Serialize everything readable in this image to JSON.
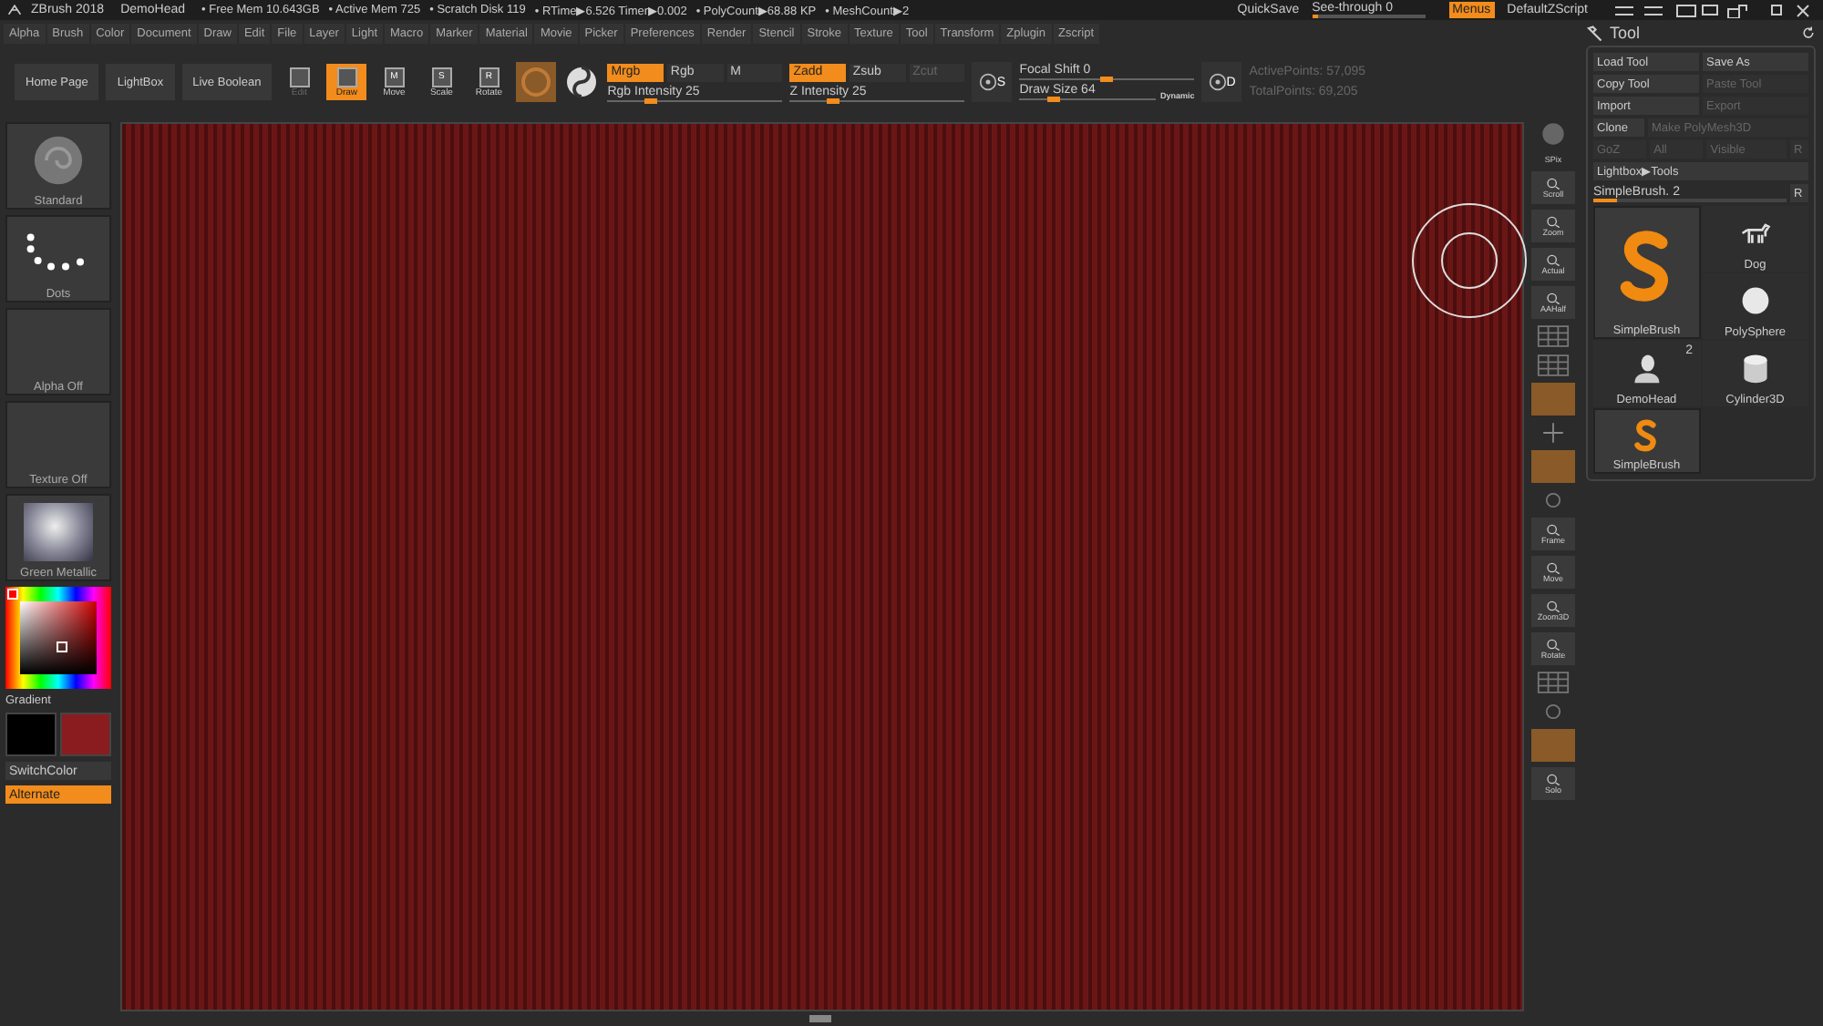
{
  "title_bar": {
    "app": "ZBrush 2018",
    "document": "DemoHead",
    "stats": [
      "• Free Mem 10.643GB",
      "• Active Mem 725",
      "• Scratch Disk 119",
      "• RTime▶6.526 Timer▶0.002",
      "• PolyCount▶68.88 KP",
      "• MeshCount▶2"
    ],
    "quicksave": "QuickSave",
    "see_through": {
      "label": "See-through  0",
      "level": 0.06
    },
    "menus": {
      "label": "Menus",
      "on": true
    },
    "script": "DefaultZScript"
  },
  "menu_bar": [
    "Alpha",
    "Brush",
    "Color",
    "Document",
    "Draw",
    "Edit",
    "File",
    "Layer",
    "Light",
    "Macro",
    "Marker",
    "Material",
    "Movie",
    "Picker",
    "Preferences",
    "Render",
    "Stencil",
    "Stroke",
    "Texture",
    "Tool",
    "Transform",
    "Zplugin",
    "Zscript"
  ],
  "toolbar": {
    "nav_buttons": [
      "Home Page",
      "LightBox",
      "Live Boolean"
    ],
    "modes": [
      {
        "label": "Edit",
        "selected": false,
        "disabled": true
      },
      {
        "label": "Draw",
        "selected": true,
        "disabled": false
      },
      {
        "label": "Move",
        "key": "M",
        "selected": false,
        "disabled": false
      },
      {
        "label": "Scale",
        "key": "S",
        "selected": false,
        "disabled": false
      },
      {
        "label": "Rotate",
        "key": "R",
        "selected": false,
        "disabled": false
      }
    ],
    "color_modes": [
      {
        "label": "Mrgb",
        "on": true
      },
      {
        "label": "Rgb",
        "on": false
      },
      {
        "label": "M",
        "on": false
      }
    ],
    "rgb_intensity": {
      "label": "Rgb Intensity 25",
      "level": 0.25
    },
    "z_modes": [
      {
        "label": "Zadd",
        "on": true,
        "disabled": false
      },
      {
        "label": "Zsub",
        "on": false,
        "disabled": false
      },
      {
        "label": "Zcut",
        "on": false,
        "disabled": true
      }
    ],
    "z_intensity": {
      "label": "Z Intensity 25",
      "level": 0.25
    },
    "s_key": "S",
    "d_key": "D",
    "focal_shift": {
      "label": "Focal Shift 0",
      "level": 0.5
    },
    "draw_size": {
      "label": "Draw Size 64",
      "level": 0.25
    },
    "dynamic": "Dynamic",
    "points": [
      "ActivePoints: 57,095",
      "TotalPoints: 69,205"
    ]
  },
  "left_panel": {
    "thumbs": [
      {
        "label": "Standard",
        "kind": "brush"
      },
      {
        "label": "Dots",
        "kind": "stroke"
      },
      {
        "label": "Alpha Off",
        "kind": "empty"
      },
      {
        "label": "Texture Off",
        "kind": "empty"
      },
      {
        "label": "Green Metallic",
        "kind": "material"
      }
    ],
    "gradient": "Gradient",
    "swatches": [
      {
        "color": "#000000"
      },
      {
        "color": "#8a1c20"
      }
    ],
    "switch_color": "SwitchColor",
    "alternate": {
      "label": "Alternate",
      "on": true
    }
  },
  "right_shelf": [
    {
      "kind": "sphere"
    },
    {
      "label": "SPix",
      "kind": "text"
    },
    {
      "label": "Scroll",
      "kind": "tool"
    },
    {
      "label": "Zoom",
      "kind": "tool"
    },
    {
      "label": "Actual",
      "kind": "tool"
    },
    {
      "label": "AAHalf",
      "kind": "tool"
    },
    {
      "kind": "grid"
    },
    {
      "kind": "grid"
    },
    {
      "kind": "active"
    },
    {
      "kind": "axes"
    },
    {
      "kind": "active"
    },
    {
      "kind": "dim"
    },
    {
      "label": "Frame",
      "kind": "tool"
    },
    {
      "label": "Move",
      "kind": "tool"
    },
    {
      "label": "Zoom3D",
      "kind": "tool"
    },
    {
      "label": "Rotate",
      "kind": "tool"
    },
    {
      "kind": "grid"
    },
    {
      "kind": "dim"
    },
    {
      "kind": "active"
    },
    {
      "label": "Solo",
      "kind": "tool"
    }
  ],
  "tool_panel": {
    "title": "Tool",
    "buttons": [
      {
        "label": "Load Tool",
        "disabled": false
      },
      {
        "label": "Save As",
        "disabled": false
      },
      {
        "label": "Copy Tool",
        "disabled": false
      },
      {
        "label": "Paste Tool",
        "disabled": true
      },
      {
        "label": "Import",
        "disabled": false
      },
      {
        "label": "Export",
        "disabled": true
      }
    ],
    "clone_row": [
      {
        "label": "Clone",
        "disabled": false
      },
      {
        "label": "Make PolyMesh3D",
        "disabled": true
      }
    ],
    "goz_row": [
      {
        "label": "GoZ",
        "disabled": true
      },
      {
        "label": "All",
        "disabled": true
      },
      {
        "label": "Visible",
        "disabled": true
      },
      {
        "label": "R",
        "disabled": true
      }
    ],
    "lightbox": "Lightbox▶Tools",
    "slider": {
      "label": "SimpleBrush. 2",
      "level": 0.12
    },
    "r_button": "R",
    "tools": [
      {
        "name": "SimpleBrush",
        "kind": "brush",
        "selected": true,
        "large": true
      },
      {
        "name": "Dog",
        "kind": "dog",
        "selected": false,
        "large": false
      },
      {
        "name": "PolySphere",
        "kind": "sphere",
        "selected": false,
        "large": false
      },
      {
        "name": "DemoHead",
        "kind": "head",
        "count": "2",
        "selected": false,
        "large": false
      },
      {
        "name": "Cylinder3D",
        "kind": "cylinder",
        "selected": false,
        "large": false
      },
      {
        "name": "SimpleBrush",
        "kind": "brush",
        "selected": true,
        "large": false
      }
    ]
  }
}
